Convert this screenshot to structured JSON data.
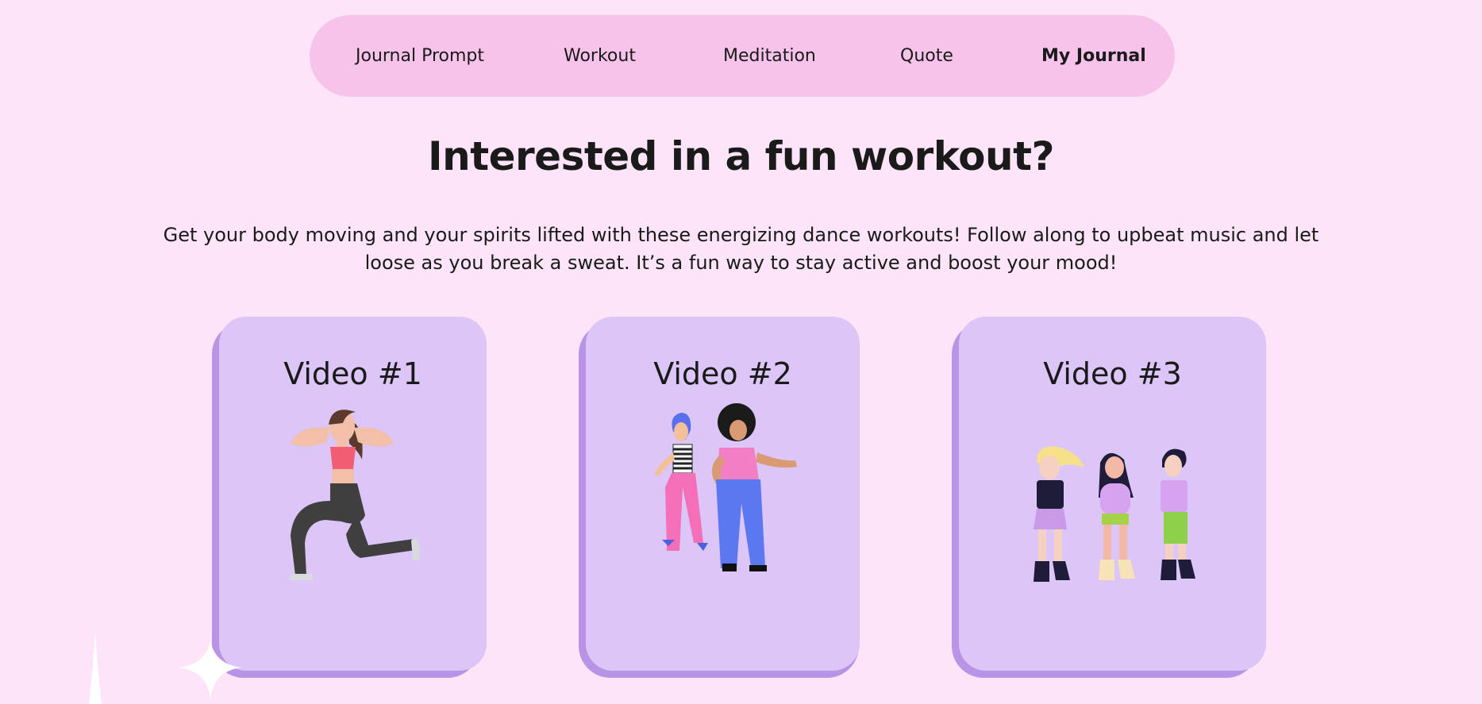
{
  "nav": {
    "items": [
      {
        "label": "Journal Prompt"
      },
      {
        "label": "Workout"
      },
      {
        "label": "Meditation"
      },
      {
        "label": "Quote"
      },
      {
        "label": "My Journal"
      }
    ]
  },
  "hero": {
    "title": "Interested in a fun workout?",
    "description": "Get your body moving and your spirits lifted with these energizing dance workouts! Follow along to upbeat music and let loose as you break a sweat. It’s a fun way to stay active and boost your mood!"
  },
  "cards": [
    {
      "title": "Video #1",
      "illustration": "lunge-woman-illustration"
    },
    {
      "title": "Video #2",
      "illustration": "two-dancers-illustration"
    },
    {
      "title": "Video #3",
      "illustration": "three-dancers-illustration"
    }
  ],
  "colors": {
    "background": "#fde4f8",
    "navbar": "#f7c3ea",
    "card": "#dcc5f7",
    "card_shadow": "#b994e6"
  }
}
